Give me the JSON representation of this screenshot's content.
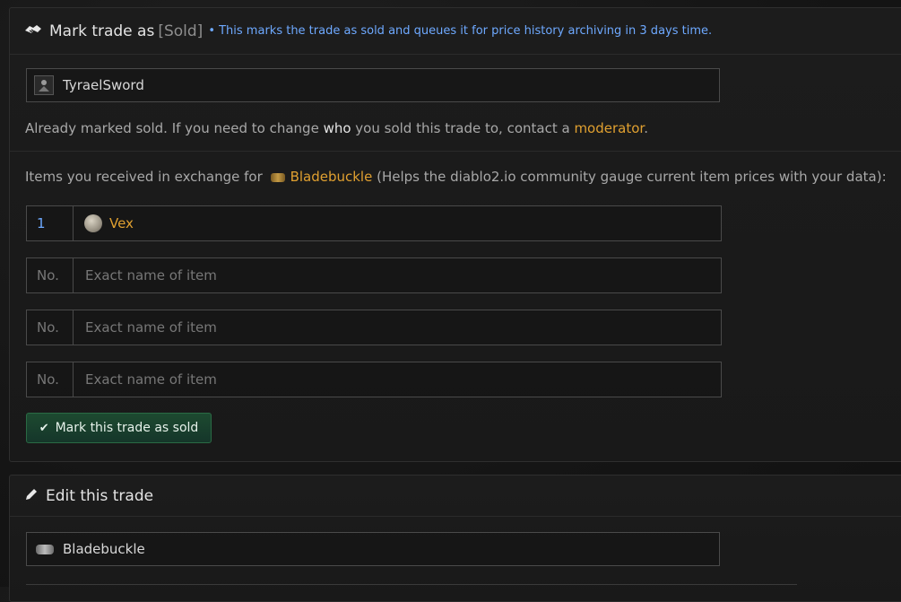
{
  "mark_sold": {
    "title": "Mark trade as",
    "sold_tag": "[Sold]",
    "note": "• This marks the trade as sold and queues it for price history archiving in 3 days time.",
    "buyer_name": "TyraelSword",
    "notice_prefix": "Already marked sold. If you need to change ",
    "notice_em": "who",
    "notice_middle": " you sold this trade to, contact a ",
    "notice_link": "moderator",
    "notice_suffix": ".",
    "exchange_prefix": "Items you received in exchange for",
    "exchange_item": "Bladebuckle",
    "exchange_suffix": "(Helps the diablo2.io community gauge current item prices with your data):",
    "rows": [
      {
        "qty": "1",
        "name": "Vex"
      },
      {
        "qty_placeholder": "No.",
        "name_placeholder": "Exact name of item"
      },
      {
        "qty_placeholder": "No.",
        "name_placeholder": "Exact name of item"
      },
      {
        "qty_placeholder": "No.",
        "name_placeholder": "Exact name of item"
      }
    ],
    "submit_label": "Mark this trade as sold"
  },
  "edit": {
    "title": "Edit this trade",
    "item_name": "Bladebuckle"
  },
  "icons": {
    "header_mark": "handshake-icon",
    "header_edit": "pencil-icon",
    "submit": "check-icon",
    "rune": "rune-icon",
    "belt": "belt-icon"
  },
  "colors": {
    "accent_link": "#e0a030",
    "note_blue": "#6ea9ff",
    "submit_bg": "#1d4a30"
  }
}
